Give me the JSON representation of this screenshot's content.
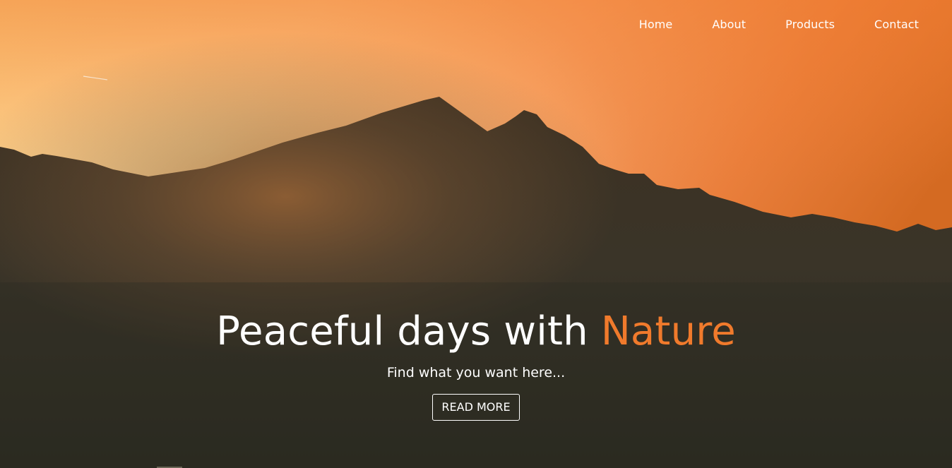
{
  "nav": {
    "items": [
      {
        "label": "Home"
      },
      {
        "label": "About"
      },
      {
        "label": "Products"
      },
      {
        "label": "Contact"
      }
    ]
  },
  "hero": {
    "title_main": "Peaceful days with ",
    "title_accent": "Nature",
    "subtitle": "Find what you want here...",
    "cta_label": "READ MORE"
  },
  "colors": {
    "accent": "#f07a2c",
    "text": "#ffffff",
    "mountain": "#2c2a22"
  }
}
